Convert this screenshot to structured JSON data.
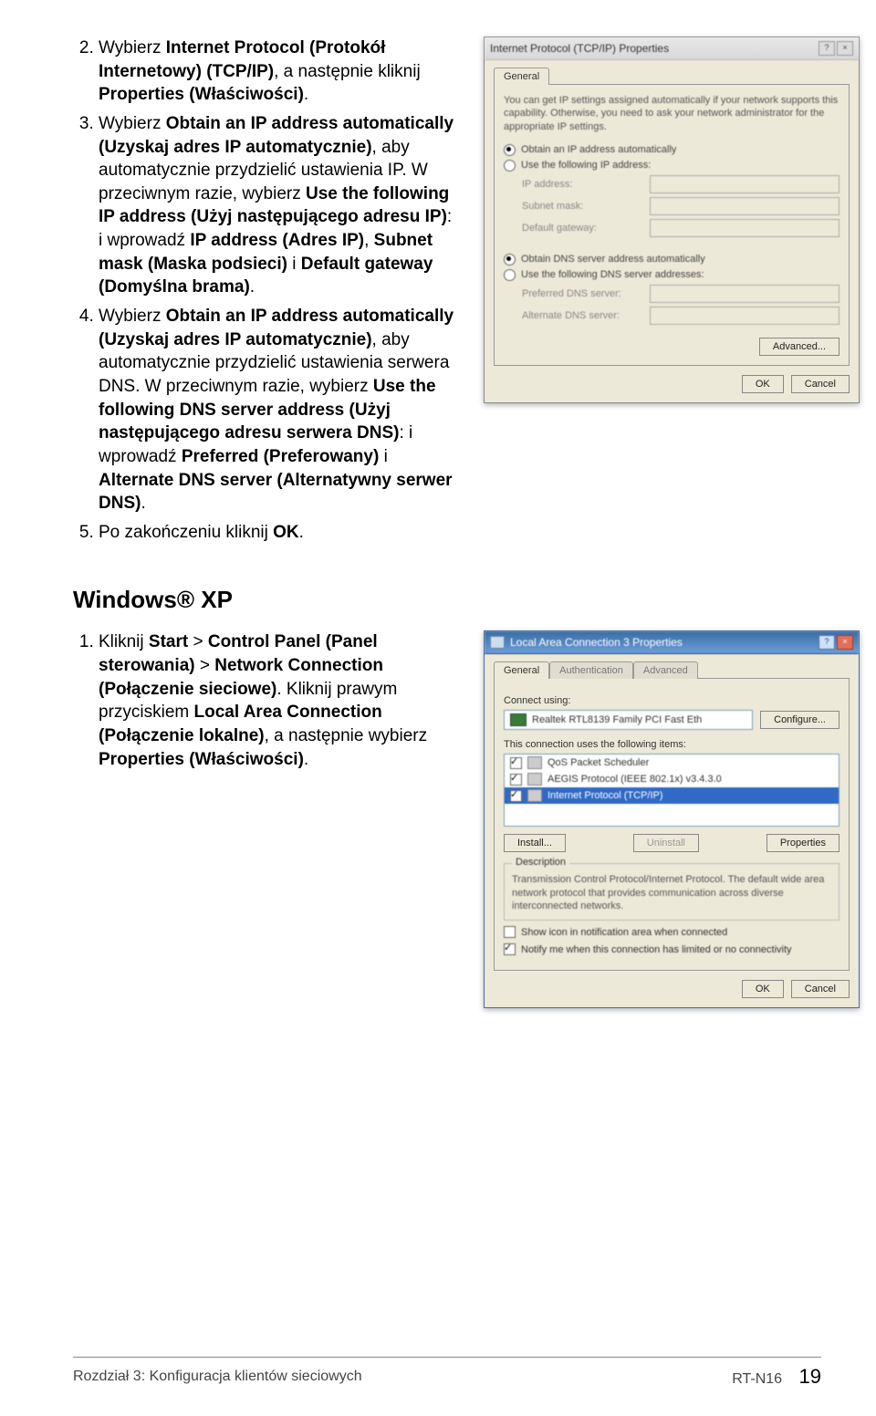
{
  "steps_top": [
    {
      "n": "2.",
      "html": "Wybierz <b>Internet Protocol (Protokół Internetowy) (TCP/IP)</b>, a następnie kliknij <b>Properties (Właściwości)</b>."
    },
    {
      "n": "3.",
      "html": "Wybierz <b>Obtain an IP address automatically (Uzyskaj adres IP automatycznie)</b>, aby automatycznie przydzielić ustawienia IP. W przeciwnym razie, wybierz <b>Use the following IP address (Użyj następującego adresu IP)</b>: i wprowadź <b>IP address (Adres IP)</b>, <b>Subnet mask (Maska podsieci)</b> i <b>Default gateway (Domyślna brama)</b>."
    },
    {
      "n": "4.",
      "html": "Wybierz <b>Obtain an IP address automatically (Uzyskaj adres IP automatycznie)</b>, aby automatycznie przydzielić ustawienia serwera DNS. W przeciwnym razie, wybierz <b>Use the following DNS server address (Użyj następującego adresu serwera DNS)</b>: i wprowadź <b>Preferred (Preferowany)</b> i <b>Alternate DNS server (Alternatywny serwer DNS)</b>."
    },
    {
      "n": "5.",
      "html": "Po zakończeniu kliknij <b>OK</b>."
    }
  ],
  "section2": {
    "heading": "Windows® XP",
    "step1_html": "Kliknij <b>Start</b> > <b>Control Panel (Panel sterowania)</b> > <b>Network Connection (Połączenie sieciowe)</b>. Kliknij prawym przyciskiem <b>Local Area Connection (Połączenie lokalne)</b>, a następnie wybierz <b>Properties (Właściwości)</b>."
  },
  "dlg1": {
    "title": "Internet Protocol (TCP/IP) Properties",
    "tab": "General",
    "desc": "You can get IP settings assigned automatically if your network supports this capability. Otherwise, you need to ask your network administrator for the appropriate IP settings.",
    "r1": "Obtain an IP address automatically",
    "r2": "Use the following IP address:",
    "f_ip": "IP address:",
    "f_mask": "Subnet mask:",
    "f_gw": "Default gateway:",
    "r3": "Obtain DNS server address automatically",
    "r4": "Use the following DNS server addresses:",
    "f_pdns": "Preferred DNS server:",
    "f_adns": "Alternate DNS server:",
    "advanced": "Advanced...",
    "ok": "OK",
    "cancel": "Cancel"
  },
  "dlg2": {
    "title": "Local Area Connection 3 Properties",
    "tabs": [
      "General",
      "Authentication",
      "Advanced"
    ],
    "connect_using": "Connect using:",
    "nic": "Realtek RTL8139 Family PCI Fast Eth",
    "configure": "Configure...",
    "uses": "This connection uses the following items:",
    "items": [
      {
        "label": "QoS Packet Scheduler",
        "sel": false
      },
      {
        "label": "AEGIS Protocol (IEEE 802.1x) v3.4.3.0",
        "sel": false
      },
      {
        "label": "Internet Protocol (TCP/IP)",
        "sel": true
      }
    ],
    "install": "Install...",
    "uninstall": "Uninstall",
    "properties": "Properties",
    "desc_legend": "Description",
    "desc_text": "Transmission Control Protocol/Internet Protocol. The default wide area network protocol that provides communication across diverse interconnected networks.",
    "chk1": "Show icon in notification area when connected",
    "chk2": "Notify me when this connection has limited or no connectivity",
    "ok": "OK",
    "cancel": "Cancel"
  },
  "footer": {
    "left": "Rozdział 3: Konfiguracja klientów sieciowych",
    "model": "RT-N16",
    "page": "19"
  }
}
